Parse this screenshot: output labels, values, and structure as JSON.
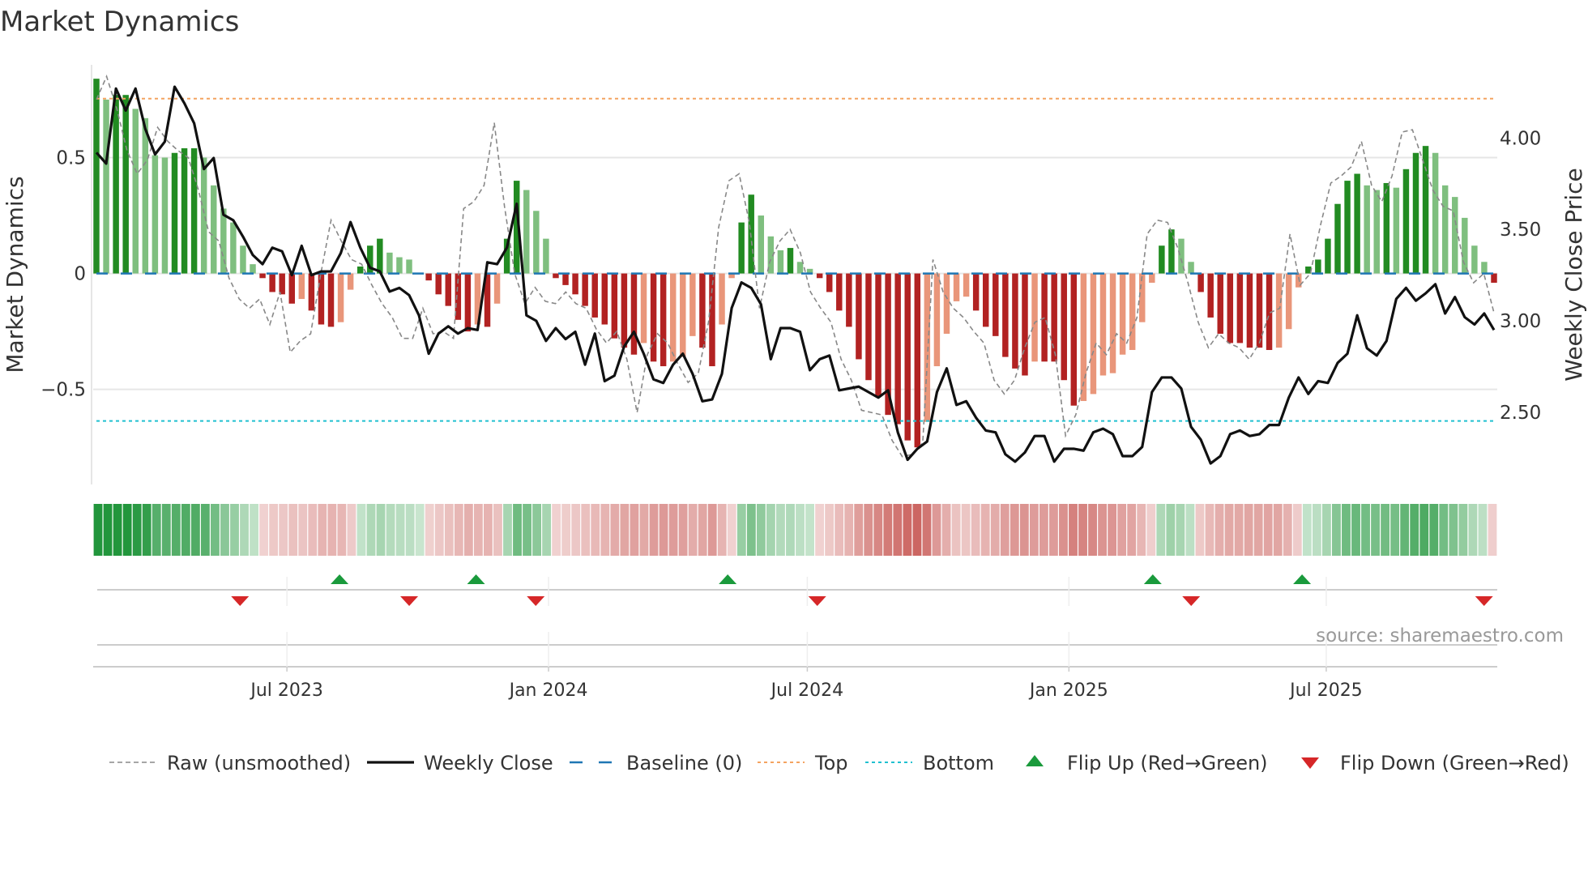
{
  "chart_data": {
    "type": "bar",
    "title": "Market Dynamics",
    "ylabel": "Market Dynamics",
    "ylabel_right": "Weekly Close Price",
    "ylim": [
      -0.91,
      0.9
    ],
    "ylim_right": [
      2.105,
      4.4
    ],
    "yticks": [
      {
        "v": 0.5,
        "label": "0.5"
      },
      {
        "v": 0,
        "label": "0"
      },
      {
        "v": -0.5,
        "label": "−0.5"
      }
    ],
    "yticks_right": [
      {
        "v": 4.0,
        "label": "4.00"
      },
      {
        "v": 3.5,
        "label": "3.50"
      },
      {
        "v": 3.0,
        "label": "3.00"
      },
      {
        "v": 2.5,
        "label": "2.50"
      }
    ],
    "xticks": [
      {
        "date": "2023-07-01",
        "label": "Jul 2023"
      },
      {
        "date": "2024-01-01",
        "label": "Jan 2024"
      },
      {
        "date": "2024-07-01",
        "label": "Jul 2024"
      },
      {
        "date": "2025-01-01",
        "label": "Jan 2025"
      },
      {
        "date": "2025-07-01",
        "label": "Jul 2025"
      }
    ],
    "date_range": [
      "2023-02-17",
      "2025-10-27"
    ],
    "top_level": 0.754,
    "bottom_level": -0.636,
    "baseline": 0,
    "market_dynamics": [
      0.84,
      0.75,
      0.77,
      0.77,
      0.71,
      0.67,
      0.51,
      0.5,
      0.52,
      0.54,
      0.54,
      0.5,
      0.38,
      0.28,
      0.22,
      0.12,
      0.04,
      -0.02,
      -0.08,
      -0.09,
      -0.13,
      -0.11,
      -0.16,
      -0.22,
      -0.23,
      -0.21,
      -0.07,
      0.03,
      0.12,
      0.15,
      0.09,
      0.07,
      0.06,
      0,
      -0.03,
      -0.09,
      -0.14,
      -0.2,
      -0.25,
      -0.22,
      -0.23,
      -0.13,
      0.15,
      0.4,
      0.36,
      0.27,
      0.15,
      -0.02,
      -0.05,
      -0.09,
      -0.14,
      -0.19,
      -0.22,
      -0.28,
      -0.32,
      -0.35,
      -0.3,
      -0.38,
      -0.4,
      -0.38,
      -0.36,
      -0.27,
      -0.32,
      -0.4,
      -0.22,
      -0.02,
      0.22,
      0.34,
      0.25,
      0.16,
      0.1,
      0.11,
      0.05,
      0.02,
      -0.02,
      -0.08,
      -0.16,
      -0.23,
      -0.37,
      -0.46,
      -0.53,
      -0.61,
      -0.65,
      -0.72,
      -0.75,
      -0.64,
      -0.4,
      -0.26,
      -0.12,
      -0.1,
      -0.16,
      -0.23,
      -0.27,
      -0.36,
      -0.41,
      -0.44,
      -0.38,
      -0.38,
      -0.38,
      -0.46,
      -0.57,
      -0.55,
      -0.52,
      -0.44,
      -0.43,
      -0.35,
      -0.33,
      -0.21,
      -0.04,
      0.12,
      0.19,
      0.15,
      0.05,
      -0.08,
      -0.19,
      -0.26,
      -0.3,
      -0.3,
      -0.32,
      -0.32,
      -0.33,
      -0.32,
      -0.24,
      -0.06,
      0.03,
      0.06,
      0.15,
      0.3,
      0.4,
      0.43,
      0.38,
      0.36,
      0.39,
      0.37,
      0.45,
      0.52,
      0.55,
      0.52,
      0.38,
      0.33,
      0.24,
      0.12,
      0.05,
      -0.04
    ],
    "raw_unsmoothed": [
      0.75,
      0.85,
      0.71,
      0.53,
      0.43,
      0.49,
      0.63,
      0.57,
      0.53,
      0.5,
      0.36,
      0.18,
      0.14,
      -0.02,
      -0.11,
      -0.15,
      -0.11,
      -0.22,
      -0.08,
      -0.34,
      -0.29,
      -0.26,
      0,
      0.23,
      0.14,
      0.06,
      0.04,
      -0.05,
      -0.13,
      -0.19,
      -0.28,
      -0.28,
      -0.15,
      -0.26,
      -0.25,
      -0.28,
      0.28,
      0.31,
      0.38,
      0.65,
      0.29,
      0,
      -0.13,
      -0.06,
      -0.12,
      -0.13,
      -0.08,
      -0.13,
      -0.15,
      -0.24,
      -0.3,
      -0.25,
      -0.37,
      -0.6,
      -0.35,
      -0.26,
      -0.3,
      -0.39,
      -0.47,
      -0.43,
      -0.21,
      0.2,
      0.4,
      0.43,
      0.22,
      -0.15,
      0.05,
      0.14,
      0.19,
      0.09,
      -0.08,
      -0.15,
      -0.21,
      -0.37,
      -0.46,
      -0.59,
      -0.6,
      -0.61,
      -0.72,
      -0.79,
      -0.78,
      -0.73,
      0.06,
      -0.08,
      -0.15,
      -0.19,
      -0.25,
      -0.3,
      -0.46,
      -0.52,
      -0.46,
      -0.32,
      -0.21,
      -0.19,
      -0.35,
      -0.7,
      -0.61,
      -0.43,
      -0.3,
      -0.35,
      -0.26,
      -0.3,
      -0.19,
      0.17,
      0.23,
      0.22,
      0.11,
      -0.04,
      -0.21,
      -0.32,
      -0.26,
      -0.3,
      -0.32,
      -0.37,
      -0.3,
      -0.17,
      -0.15,
      0.17,
      -0.05,
      0,
      0.21,
      0.39,
      0.42,
      0.46,
      0.57,
      0.38,
      0.31,
      0.42,
      0.61,
      0.62,
      0.49,
      0.36,
      0.29,
      0.27,
      0.05,
      -0.04,
      0,
      -0.17
    ],
    "weekly_close": [
      3.92,
      3.86,
      4.27,
      4.15,
      4.27,
      4.05,
      3.91,
      3.98,
      4.28,
      4.19,
      4.08,
      3.83,
      3.89,
      3.58,
      3.55,
      3.46,
      3.36,
      3.31,
      3.4,
      3.38,
      3.25,
      3.41,
      3.25,
      3.27,
      3.27,
      3.37,
      3.54,
      3.4,
      3.29,
      3.27,
      3.16,
      3.18,
      3.14,
      3.03,
      2.82,
      2.93,
      2.97,
      2.93,
      2.96,
      2.95,
      3.32,
      3.31,
      3.4,
      3.64,
      3.03,
      3.0,
      2.89,
      2.96,
      2.9,
      2.94,
      2.76,
      2.93,
      2.67,
      2.7,
      2.86,
      2.94,
      2.82,
      2.68,
      2.66,
      2.76,
      2.82,
      2.71,
      2.56,
      2.57,
      2.71,
      3.07,
      3.21,
      3.18,
      3.09,
      2.79,
      2.96,
      2.96,
      2.94,
      2.73,
      2.79,
      2.81,
      2.62,
      2.63,
      2.64,
      2.61,
      2.58,
      2.62,
      2.39,
      2.24,
      2.3,
      2.34,
      2.61,
      2.74,
      2.54,
      2.56,
      2.47,
      2.4,
      2.39,
      2.27,
      2.23,
      2.28,
      2.37,
      2.37,
      2.23,
      2.3,
      2.3,
      2.29,
      2.39,
      2.41,
      2.38,
      2.26,
      2.26,
      2.31,
      2.61,
      2.69,
      2.69,
      2.63,
      2.42,
      2.35,
      2.22,
      2.26,
      2.38,
      2.4,
      2.37,
      2.38,
      2.43,
      2.43,
      2.58,
      2.69,
      2.6,
      2.67,
      2.66,
      2.77,
      2.82,
      3.03,
      2.85,
      2.81,
      2.89,
      3.12,
      3.18,
      3.11,
      3.15,
      3.2,
      3.04,
      3.13,
      3.02,
      2.98,
      3.04,
      2.95
    ],
    "flip_up": [
      "2023-08-07",
      "2023-11-11",
      "2024-05-06",
      "2025-03-01",
      "2025-06-14"
    ],
    "flip_down": [
      "2023-05-29",
      "2023-09-25",
      "2023-12-23",
      "2024-07-08",
      "2025-03-28",
      "2025-10-20"
    ],
    "colors": {
      "green_strong": "#228b22",
      "green_light": "#7fbf7f",
      "red_strong": "#b22222",
      "red_light": "#e9967a",
      "top": "#f4a460",
      "bottom": "#20c0d0",
      "baseline": "#1f77b4",
      "flip_up": "#1a9a3c",
      "flip_down": "#d62728"
    },
    "source": "source: sharemaestro.com",
    "legend": [
      {
        "key": "raw",
        "label": "Raw (unsmoothed)"
      },
      {
        "key": "close",
        "label": "Weekly Close"
      },
      {
        "key": "baseline",
        "label": "Baseline (0)"
      },
      {
        "key": "top",
        "label": "Top"
      },
      {
        "key": "bottom",
        "label": "Bottom"
      },
      {
        "key": "up",
        "label": "Flip Up (Red→Green)"
      },
      {
        "key": "down",
        "label": "Flip Down (Green→Red)"
      }
    ]
  }
}
